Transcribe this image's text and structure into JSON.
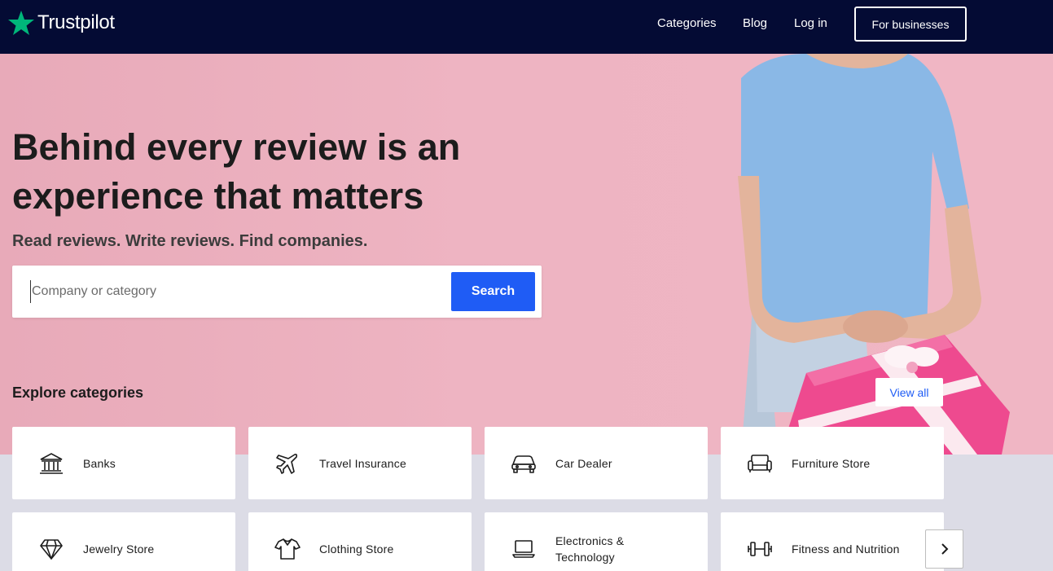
{
  "header": {
    "brand": "Trustpilot",
    "nav": {
      "categories": "Categories",
      "blog": "Blog",
      "login": "Log in",
      "businesses": "For businesses"
    },
    "colors": {
      "background": "#040b34",
      "star": "#00b67a"
    }
  },
  "hero": {
    "title": "Behind every review is an experience that matters",
    "subtitle": "Read reviews. Write reviews. Find companies.",
    "search": {
      "placeholder": "Company or category",
      "value": "",
      "button": "Search"
    },
    "colors": {
      "background": "#eeb4c2",
      "search_button": "#1f5cf5"
    }
  },
  "explore": {
    "heading": "Explore categories",
    "view_all": "View all",
    "categories": [
      {
        "label": "Banks",
        "icon": "bank-icon"
      },
      {
        "label": "Travel Insurance",
        "icon": "airplane-icon"
      },
      {
        "label": "Car Dealer",
        "icon": "car-icon"
      },
      {
        "label": "Furniture Store",
        "icon": "sofa-icon"
      },
      {
        "label": "Jewelry Store",
        "icon": "diamond-icon"
      },
      {
        "label": "Clothing Store",
        "icon": "shirt-icon"
      },
      {
        "label": "Electronics & Technology",
        "icon": "laptop-icon"
      },
      {
        "label": "Fitness and Nutrition",
        "icon": "dumbbell-icon"
      }
    ],
    "next_icon": "chevron-right-icon"
  }
}
